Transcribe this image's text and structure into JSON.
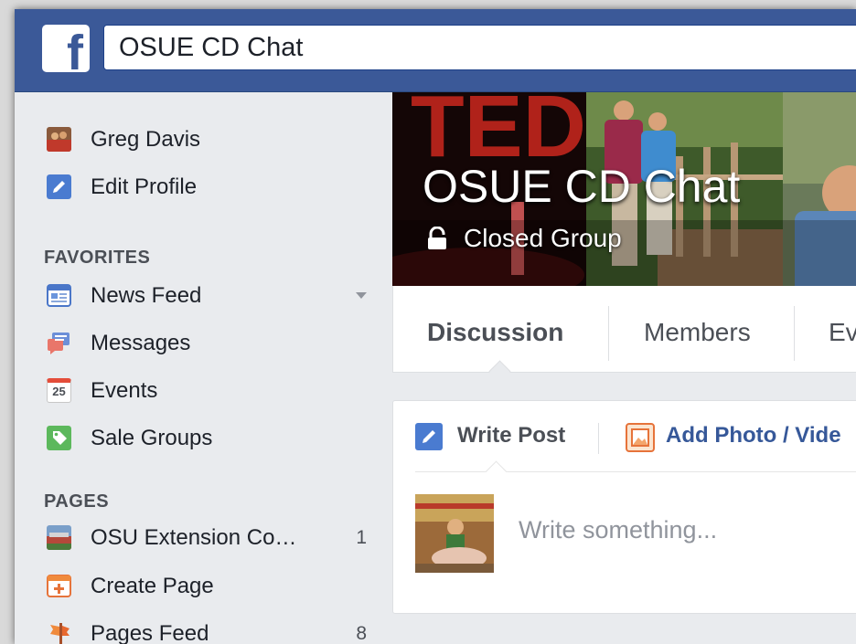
{
  "topbar": {
    "logo": "f",
    "search_value": "OSUE CD Chat"
  },
  "user": {
    "name": "Greg Davis",
    "edit_label": "Edit Profile"
  },
  "favorites": {
    "heading": "FAVORITES",
    "items": [
      {
        "label": "News Feed",
        "icon": "news-feed-icon"
      },
      {
        "label": "Messages",
        "icon": "messages-icon"
      },
      {
        "label": "Events",
        "icon": "events-icon",
        "icon_text": "25"
      },
      {
        "label": "Sale Groups",
        "icon": "sale-groups-icon"
      }
    ]
  },
  "pages": {
    "heading": "PAGES",
    "items": [
      {
        "label": "OSU Extension Co…",
        "count": "1"
      },
      {
        "label": "Create Page"
      },
      {
        "label": "Pages Feed",
        "count": "8"
      }
    ]
  },
  "group": {
    "title": "OSUE CD Chat",
    "privacy": "Closed Group"
  },
  "tabs": [
    "Discussion",
    "Members",
    "Ev"
  ],
  "composer": {
    "write_post": "Write Post",
    "add_photo": "Add Photo / Vide",
    "placeholder": "Write something..."
  },
  "colors": {
    "brand": "#3b5998",
    "link": "#365899",
    "background": "#e9ebee"
  }
}
